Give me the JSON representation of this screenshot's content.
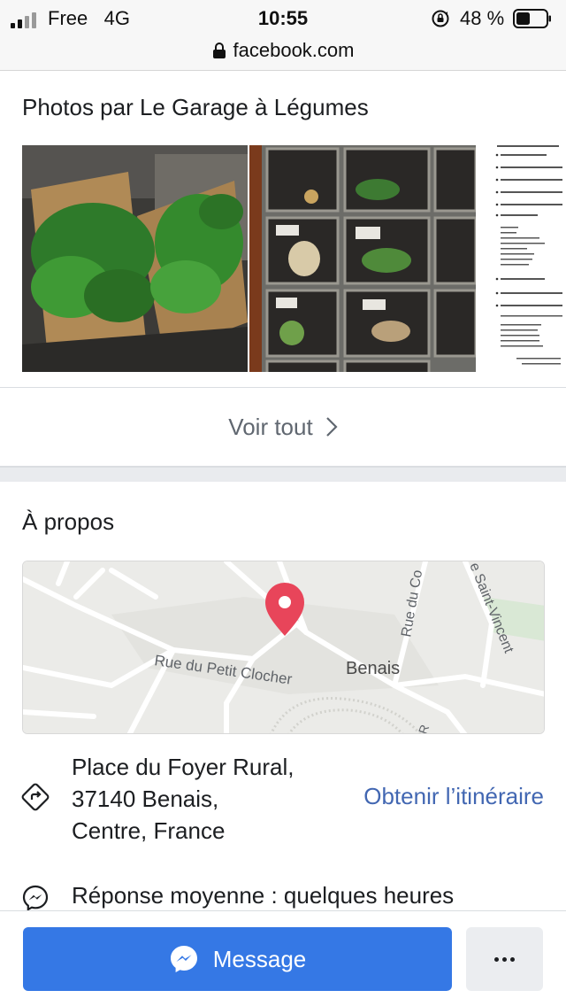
{
  "status_bar": {
    "carrier": "Free",
    "network": "4G",
    "time": "10:55",
    "battery_percent": "48 %",
    "signal_bars": 4,
    "signal_bars_active": 2,
    "battery_level": 0.48
  },
  "url_bar": {
    "domain": "facebook.com",
    "icon": "padlock-icon"
  },
  "photos": {
    "title": "Photos par Le Garage à Légumes",
    "items": [
      {
        "name": "spinach-bags-photo"
      },
      {
        "name": "vending-lockers-photo"
      },
      {
        "name": "product-list-photo"
      }
    ],
    "see_all_label": "Voir tout"
  },
  "about": {
    "title": "À propos",
    "map": {
      "labels": [
        "Rue du Petit Clocher",
        "Benais",
        "Rue du Co",
        "e Saint-Vincent",
        "R"
      ],
      "pin_color": "#e8455a"
    },
    "address_lines": [
      "Place du Foyer Rural,",
      "37140 Benais,",
      "Centre, France"
    ],
    "directions_label": "Obtenir l’itinéraire",
    "response_label": "Réponse moyenne : quelques heures"
  },
  "actions": {
    "message_label": "Message",
    "more_icon": "more-dots-icon"
  },
  "colors": {
    "brand_blue": "#3578e5",
    "link_blue": "#4267b2",
    "muted_text": "#606770"
  }
}
